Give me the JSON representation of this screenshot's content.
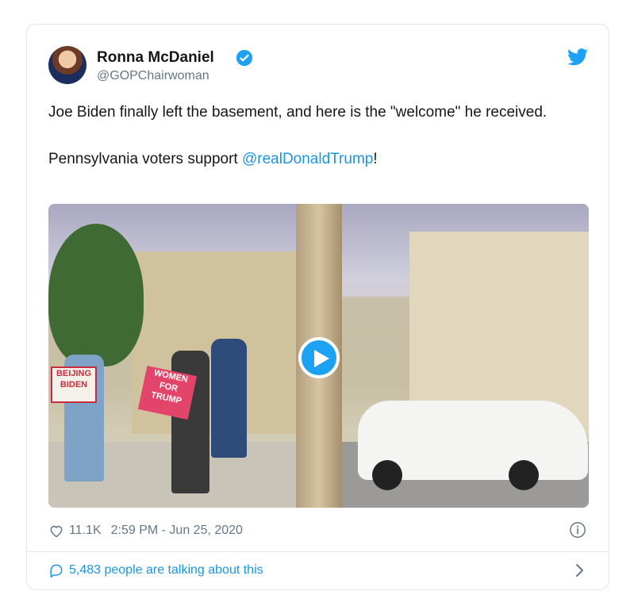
{
  "author": {
    "display_name": "Ronna McDaniel",
    "handle": "@GOPChairwoman"
  },
  "tweet": {
    "line1": "Joe Biden finally left the basement, and here is the \"welcome\" he received.",
    "line2_prefix": "Pennsylvania voters support ",
    "mention": "@realDonaldTrump",
    "line2_suffix": "!"
  },
  "media": {
    "sign_left": "BEIJING BIDEN",
    "sign_right": "WOMEN FOR TRUMP"
  },
  "stats": {
    "likes": "11.1K",
    "timestamp": "2:59 PM - Jun 25, 2020"
  },
  "conversation": {
    "label": "5,483 people are talking about this"
  },
  "colors": {
    "accent": "#1b95e0",
    "verified": "#1da1f2",
    "muted": "#657786"
  }
}
